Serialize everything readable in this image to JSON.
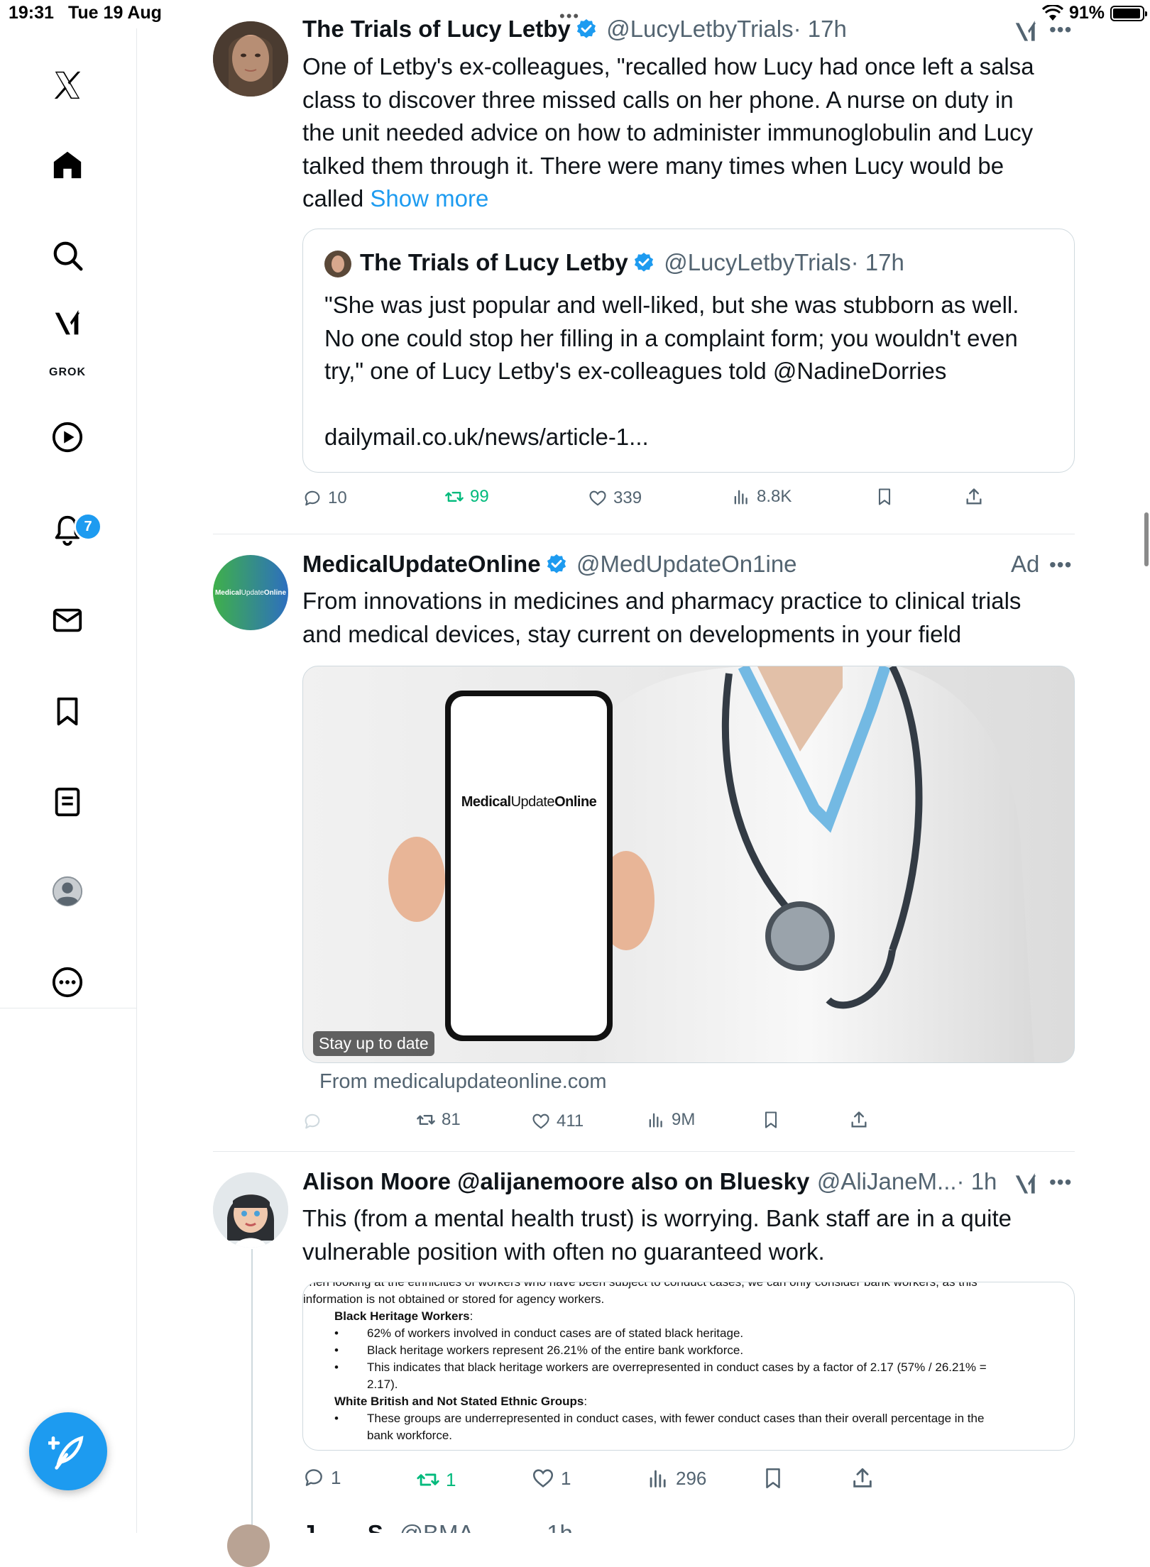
{
  "status_bar": {
    "time": "19:31",
    "date": "Tue 19 Aug",
    "battery": "91%"
  },
  "sidebar": {
    "grok_label": "GROK",
    "notifications_count": "7",
    "items": [
      "x-logo",
      "home",
      "search",
      "grok",
      "video",
      "notifications",
      "messages",
      "bookmarks",
      "lists",
      "profile",
      "more"
    ]
  },
  "tweets": [
    {
      "name": "The Trials of Lucy Letby",
      "handle": "@LucyLetbyTrials",
      "time": "· 17h",
      "lines": [
        "One of Letby's ex-colleagues, \"recalled how Lucy had once left a salsa",
        "class to discover three missed calls on her phone. A nurse on duty in",
        "the unit needed advice on how to administer immunoglobulin and Lucy",
        "talked them through it. There were many times when Lucy would be"
      ],
      "last_line": "called",
      "show_more": "Show more",
      "quote": {
        "name": "The Trials of Lucy Letby",
        "handle": "@LucyLetbyTrials",
        "time": "· 17h",
        "lines": [
          "\"She was just popular and well-liked, but she was stubborn as well.",
          "No one could stop her filling in a complaint form; you wouldn't even",
          "try,\" one of Lucy Letby's ex-colleagues told @NadineDorries"
        ],
        "link": "dailymail.co.uk/news/article-1..."
      },
      "replies": "10",
      "reposts": "99",
      "likes": "339",
      "views": "8.8K"
    },
    {
      "name": "MedicalUpdateOnline",
      "handle": "@MedUpdateOn1ine",
      "ad_label": "Ad",
      "lines": [
        "From innovations in medicines and pharmacy practice to clinical trials",
        "and medical devices, stay current on developments in your field"
      ],
      "logo_text_a": "Medical",
      "logo_text_b": "Update",
      "logo_text_c": "Online",
      "image_label": "Stay up to date",
      "source": "From medicalupdateonline.com",
      "reposts": "81",
      "likes": "411",
      "views": "9M"
    },
    {
      "name": "Alison Moore @alijanemoore also on Bluesky",
      "handle": "@AliJaneM...",
      "time": "· 1h",
      "lines": [
        "This (from a mental health trust) is worrying. Bank staff are in a quite",
        "vulnerable position with often no guaranteed work."
      ],
      "doc": {
        "line0": "vhen looking at the ethnicities of workers who have been subject to conduct cases, we can only consider bank workers, as this",
        "line1": "information is not obtained or stored for agency workers.",
        "h1": "Black Heritage Workers",
        "b1": "62% of workers involved in conduct cases are of stated black heritage.",
        "b2": "Black heritage workers represent 26.21% of the entire bank workforce.",
        "b3a": "This indicates that black heritage workers are overrepresented in conduct cases by a factor of 2.17 (57% / 26.21% =",
        "b3b": "2.17).",
        "h2": "White British and Not Stated Ethnic Groups",
        "b4a": "These groups are underrepresented in conduct cases, with fewer conduct cases than their overall percentage in the",
        "b4b": "bank workforce."
      },
      "replies": "1",
      "reposts": "1",
      "likes": "1",
      "views": "296"
    }
  ],
  "next_tweet_partial": {
    "name": "J....... S..",
    "handle": "@BMA.........",
    "time": "· 1h"
  }
}
